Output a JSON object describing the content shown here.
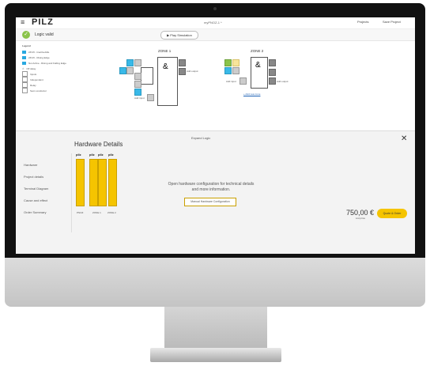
{
  "app": {
    "menu_icon": "hamburger-icon",
    "logo": "PILZ",
    "title": "myPNOZ-1 *",
    "projects_label": "Projects",
    "save_label": "Save Project"
  },
  "status": {
    "valid_label": "Logic valid",
    "simulation_label": "Play Simulation"
  },
  "legend": {
    "title": "Legend",
    "items": [
      "24V/0 - Inactive/idle",
      "24V/0 - Rising Edge",
      "Not Active - Rising and Falling Edge",
      "Off delay",
      "Inputs",
      "Independent",
      "Relay",
      "Semi-conductor"
    ]
  },
  "zones": [
    {
      "title": "ZONE 1",
      "add_output": "Add output",
      "add_input": "Add input"
    },
    {
      "title": "ZONE 2",
      "add_output": "Add output",
      "add_input": "Add input",
      "add_zone": "+ Add new zone"
    }
  ],
  "lower": {
    "expand_label": "Expand Logic",
    "hardware_title": "Hardware Details",
    "sidebar": [
      "Hardware",
      "Project details",
      "Terminal Diagram",
      "Cause and effect",
      "Order Summary"
    ],
    "devices": [
      "pilz",
      "pilz",
      "pilz",
      "pilz"
    ],
    "device_labels": [
      "PNOZ",
      "ZONE 1",
      "ZONE 2"
    ],
    "open_hw_text": "Open hardware configuration for technical details and more information.",
    "manual_btn": "Manual Hardware Configuration",
    "price": "750,00 €",
    "price_label": "List price",
    "order_btn": "Quote & Order"
  }
}
